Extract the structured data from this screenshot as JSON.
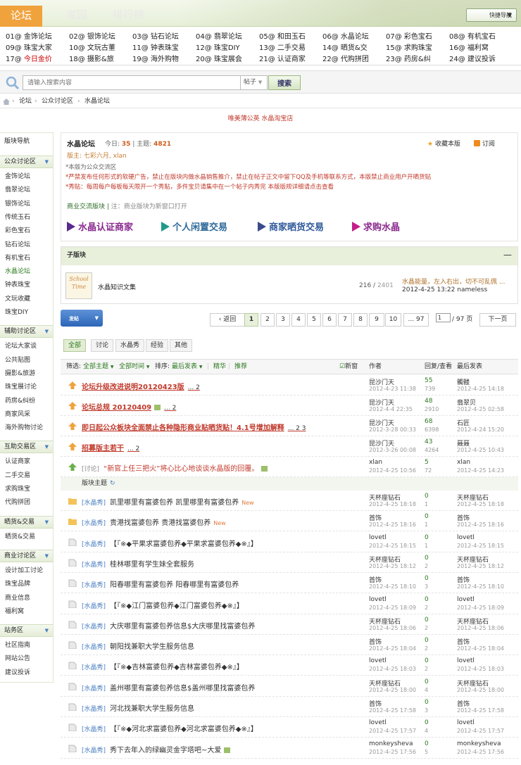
{
  "topnav": {
    "tabs": [
      "论坛",
      "家园",
      "排行榜"
    ],
    "quick_nav": "快捷导航"
  },
  "forum_grid": [
    [
      "01@ 金饰论坛",
      "02@ 银饰论坛",
      "03@ 钻石论坛",
      "04@ 翡翠论坛",
      "05@ 和田玉石",
      "06@ 水晶论坛",
      "07@ 彩色宝石",
      "08@ 有机宝石"
    ],
    [
      "09@ 珠宝大家",
      "10@ 文玩古董",
      "11@ 钟表珠宝",
      "12@ 珠宝DIY",
      "13@ 二手交易",
      "14@ 晒货&交",
      "15@ 求购珠宝",
      "16@ 福利窝"
    ],
    [
      "17@ 今日金价",
      "18@ 摄影&旅",
      "19@ 海外购物",
      "20@ 珠宝展会",
      "21@ 认证商家",
      "22@ 代购拼团",
      "23@ 药房&纠",
      "24@ 建议投诉"
    ]
  ],
  "search": {
    "placeholder": "请输入搜索内容",
    "type": "帖子",
    "button": "搜索"
  },
  "breadcrumb": [
    "论坛",
    "公众讨论区",
    "水晶论坛"
  ],
  "promo": "唯美薄公英 水晶淘宝店",
  "sidebar": {
    "title": "版块导航",
    "groups": [
      {
        "name": "公众讨论区",
        "items": [
          "金饰论坛",
          "翡翠论坛",
          "银饰论坛",
          "传统玉石",
          "彩色宝石",
          "钻石论坛",
          "有机宝石",
          "水晶论坛",
          "钟表珠宝",
          "文玩收藏",
          "珠宝DIY"
        ]
      },
      {
        "name": "辅助讨论区",
        "items": [
          "论坛大家谈",
          "公共贴图",
          "摄影&旅游",
          "珠宝展讨论",
          "药房&纠纷",
          "商家风采",
          "海外购物讨论"
        ]
      },
      {
        "name": "互助交易区",
        "items": [
          "认证商家",
          "二手交易",
          "求购珠宝",
          "代购拼团"
        ]
      },
      {
        "name": "晒货&交易",
        "items": [
          "晒货&交易"
        ]
      },
      {
        "name": "商业讨论区",
        "items": [
          "设计加工讨论",
          "珠宝品牌",
          "商业信息",
          "福利窝"
        ]
      },
      {
        "name": "站务区",
        "items": [
          "社区指南",
          "网站公告",
          "建议投诉"
        ]
      }
    ]
  },
  "forum": {
    "name": "水晶论坛",
    "today_label": "今日:",
    "today": "35",
    "topics_label": "主题:",
    "topics": "4821",
    "mods_label": "版主:",
    "mods": "七彩六月, xlan",
    "fav": "收藏本版",
    "subscribe": "订阅",
    "rules": [
      "*本版为公众交流区",
      "*严禁发布任何形式的软硬广告，禁止在版块内做水晶销售推介，禁止在帖子正文中留下QQ及手机等联系方式，本版禁止商业用户开晒货贴",
      "*秀贴：每周每户每板每天限开一个秀贴，多件宝贝请集中在一个帖子内秀完 本版版规详细请点击查看"
    ],
    "commerce_title": "商业交流版块",
    "commerce_note": "注：商业版块为新窗口打开",
    "big_links": [
      "水晶认证商家",
      "个人闲置交易",
      "商家晒货交易",
      "求购水晶"
    ]
  },
  "subforum": {
    "header": "子版块",
    "collapse": "—",
    "image_text": "School Time",
    "name": "水晶知识文集",
    "topics": "216",
    "posts": "2401",
    "last_title": "水晶能量，左入右出，切不可乱佩 ...",
    "last_info": "2012-4-25 13:22 nameless"
  },
  "toolbar": {
    "post": "发帖",
    "prev": "返回",
    "pages": [
      "1",
      "2",
      "3",
      "4",
      "5",
      "6",
      "7",
      "8",
      "9",
      "10",
      "... 97"
    ],
    "page_input": "1",
    "page_total": "/ 97 页",
    "next": "下一页"
  },
  "type_tabs": [
    "全部",
    "讨论",
    "水晶秀",
    "经验",
    "其他"
  ],
  "list_head": {
    "filter": "筛选:",
    "all_topics": "全部主题",
    "all_time": "全部时间",
    "sort": "排序:",
    "sort_value": "最后发表",
    "digest": "精华",
    "recommend": "推荐",
    "newwin": "新窗",
    "author": "作者",
    "reply_view": "回复/查看",
    "last": "最后发表"
  },
  "sticky": [
    {
      "title": "论坛升级改进说明20120423版",
      "pages": "... 2",
      "author": "昆沙门天",
      "date": "2012-4-23 11:38",
      "replies": "55",
      "views": "739",
      "last_user": "髑髅",
      "last_date": "2012-4-25 14:18"
    },
    {
      "title": "论坛总规 20120409",
      "pages": "... 2",
      "author": "昆沙门天",
      "date": "2012-4-4 22:35",
      "replies": "48",
      "views": "2910",
      "last_user": "翡翠贝",
      "last_date": "2012-4-25 02:58"
    },
    {
      "title": "即日起公众板块全面禁止各种隐形商业贴晒货贴！4.1号增加解释",
      "pages": "... 2 3",
      "author": "昆沙门天",
      "date": "2012-3-28 00:33",
      "replies": "68",
      "views": "6398",
      "last_user": "石匠",
      "last_date": "2012-4-24 15:20"
    },
    {
      "title": "招募版主若干",
      "pages": "... 2",
      "author": "昆沙门天",
      "date": "2012-3-26 00:08",
      "replies": "43",
      "views": "4264",
      "last_user": "聂聂",
      "last_date": "2012-4-25 10:43"
    },
    {
      "title": "“新官上任三把火”将心比心地谈谈水晶版的回覆。",
      "tag": "[讨论]",
      "pages": "",
      "author": "xlan",
      "date": "2012-4-25 10:56",
      "replies": "5",
      "views": "72",
      "last_user": "xlan",
      "last_date": "2012-4-25 14:23"
    }
  ],
  "normal_head": "版块主题",
  "threads": [
    {
      "tag": "[水晶秀]",
      "title": "凯里哪里有富婆包养 凯里哪里有富婆包养",
      "new": "New",
      "author": "天杯座钻石",
      "date": "2012-4-25 18:18",
      "replies": "0",
      "views": "1",
      "last_user": "天杯座钻石",
      "last_date": "2012-4-25 18:18"
    },
    {
      "tag": "[水晶秀]",
      "title": "贵港找富婆包养 贵港找富婆包养",
      "new": "New",
      "author": "首饰",
      "date": "2012-4-25 18:16",
      "replies": "0",
      "views": "1",
      "last_user": "首饰",
      "last_date": "2012-4-25 18:16"
    },
    {
      "tag": "[水晶秀]",
      "title": "【『※◆平果求富婆包养◆平果求富婆包养◆※』】",
      "new": "",
      "author": "lovetl",
      "date": "2012-4-25 18:15",
      "replies": "0",
      "views": "1",
      "last_user": "lovetl",
      "last_date": "2012-4-25 18:15"
    },
    {
      "tag": "[水晶秀]",
      "title": "桂林哪里有学生妹全套服务",
      "new": "",
      "author": "天杯座钻石",
      "date": "2012-4-25 18:12",
      "replies": "0",
      "views": "2",
      "last_user": "天杯座钻石",
      "last_date": "2012-4-25 18:12"
    },
    {
      "tag": "[水晶秀]",
      "title": "阳春哪里有富婆包养 阳春哪里有富婆包养",
      "new": "",
      "author": "首饰",
      "date": "2012-4-25 18:10",
      "replies": "0",
      "views": "3",
      "last_user": "首饰",
      "last_date": "2012-4-25 18:10"
    },
    {
      "tag": "[水晶秀]",
      "title": "【『※◆江门富婆包养◆江门富婆包养◆※』】",
      "new": "",
      "author": "lovetl",
      "date": "2012-4-25 18:09",
      "replies": "0",
      "views": "2",
      "last_user": "lovetl",
      "last_date": "2012-4-25 18:09"
    },
    {
      "tag": "[水晶秀]",
      "title": "大庆哪里有富婆包养信息$大庆哪里找富婆包养",
      "new": "",
      "author": "天杯座钻石",
      "date": "2012-4-25 18:06",
      "replies": "0",
      "views": "2",
      "last_user": "天杯座钻石",
      "last_date": "2012-4-25 18:06"
    },
    {
      "tag": "[水晶秀]",
      "title": "朝阳找兼职大学生服务信息",
      "new": "",
      "author": "首饰",
      "date": "2012-4-25 18:04",
      "replies": "0",
      "views": "2",
      "last_user": "首饰",
      "last_date": "2012-4-25 18:04"
    },
    {
      "tag": "[水晶秀]",
      "title": "【『※◆吉林富婆包养◆吉林富婆包养◆※』】",
      "new": "",
      "author": "lovetl",
      "date": "2012-4-25 18:03",
      "replies": "0",
      "views": "2",
      "last_user": "lovetl",
      "last_date": "2012-4-25 18:03"
    },
    {
      "tag": "[水晶秀]",
      "title": "盖州哪里有富婆包养信息$盖州哪里找富婆包养",
      "new": "",
      "author": "天杯座钻石",
      "date": "2012-4-25 18:00",
      "replies": "0",
      "views": "4",
      "last_user": "天杯座钻石",
      "last_date": "2012-4-25 18:00"
    },
    {
      "tag": "[水晶秀]",
      "title": "河北找兼职大学生服务信息",
      "new": "",
      "author": "首饰",
      "date": "2012-4-25 17:58",
      "replies": "0",
      "views": "3",
      "last_user": "首饰",
      "last_date": "2012-4-25 17:58"
    },
    {
      "tag": "[水晶秀]",
      "title": "【『※◆河北求富婆包养◆河北求富婆包养◆※』】",
      "new": "",
      "author": "lovetl",
      "date": "2012-4-25 17:57",
      "replies": "0",
      "views": "4",
      "last_user": "lovetl",
      "last_date": "2012-4-25 17:57"
    },
    {
      "tag": "[水晶秀]",
      "title": "秀下去年入的绿幽灵金字塔吧~大爱",
      "new": "",
      "author": "monkeysheva",
      "date": "2012-4-25 17:56",
      "replies": "0",
      "views": "5",
      "last_user": "monkeysheva",
      "last_date": "2012-4-25 17:56"
    }
  ],
  "colors": {
    "accent_orange": "#f0a23c",
    "green": "#2b7a1e",
    "red": "#c0392b",
    "blue": "#4a7ec0"
  }
}
